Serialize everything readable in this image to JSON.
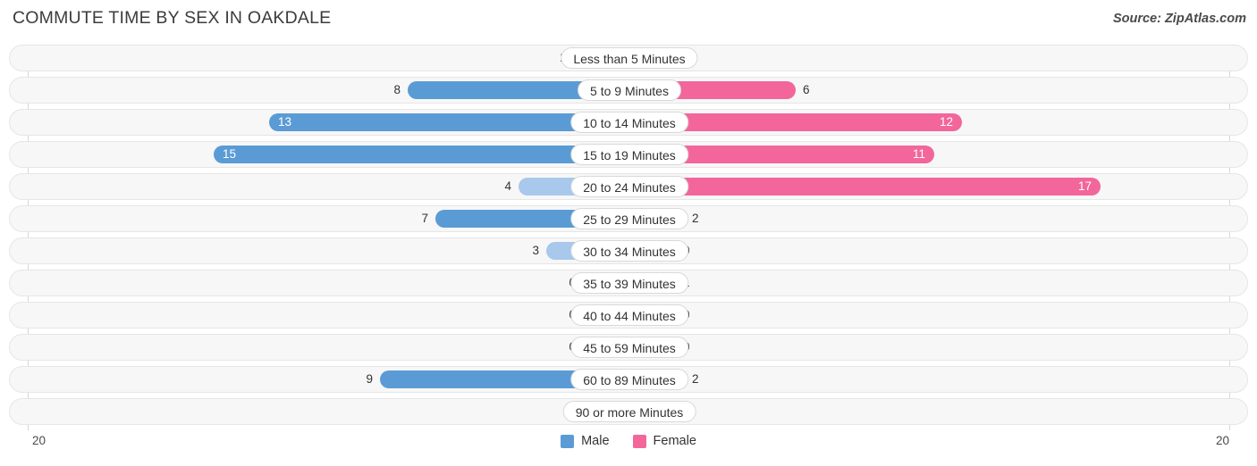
{
  "header": {
    "title": "COMMUTE TIME BY SEX IN OAKDALE",
    "source": "Source: ZipAtlas.com"
  },
  "axis": {
    "left_max_label": "20",
    "right_max_label": "20"
  },
  "legend": {
    "items": [
      {
        "label": "Male",
        "color": "#5b9bd5"
      },
      {
        "label": "Female",
        "color": "#f2669b"
      }
    ]
  },
  "chart_data": {
    "type": "bar",
    "orientation": "horizontal-diverging",
    "title": "COMMUTE TIME BY SEX IN OAKDALE",
    "xlabel": "",
    "ylabel": "",
    "xlim": [
      20,
      20
    ],
    "grid": false,
    "legend_position": "bottom-center",
    "categories": [
      "Less than 5 Minutes",
      "5 to 9 Minutes",
      "10 to 14 Minutes",
      "15 to 19 Minutes",
      "20 to 24 Minutes",
      "25 to 29 Minutes",
      "30 to 34 Minutes",
      "35 to 39 Minutes",
      "40 to 44 Minutes",
      "45 to 59 Minutes",
      "60 to 89 Minutes",
      "90 or more Minutes"
    ],
    "series": [
      {
        "name": "Male",
        "values": [
          2,
          8,
          13,
          15,
          4,
          7,
          3,
          0,
          0,
          0,
          9,
          0
        ]
      },
      {
        "name": "Female",
        "values": [
          0,
          6,
          12,
          11,
          17,
          2,
          0,
          1,
          0,
          0,
          2,
          0
        ]
      }
    ]
  },
  "rows": [
    {
      "label": "Less than 5 Minutes",
      "male": "2",
      "female": "0"
    },
    {
      "label": "5 to 9 Minutes",
      "male": "8",
      "female": "6"
    },
    {
      "label": "10 to 14 Minutes",
      "male": "13",
      "female": "12"
    },
    {
      "label": "15 to 19 Minutes",
      "male": "15",
      "female": "11"
    },
    {
      "label": "20 to 24 Minutes",
      "male": "4",
      "female": "17"
    },
    {
      "label": "25 to 29 Minutes",
      "male": "7",
      "female": "2"
    },
    {
      "label": "30 to 34 Minutes",
      "male": "3",
      "female": "0"
    },
    {
      "label": "35 to 39 Minutes",
      "male": "0",
      "female": "1"
    },
    {
      "label": "40 to 44 Minutes",
      "male": "0",
      "female": "0"
    },
    {
      "label": "45 to 59 Minutes",
      "male": "0",
      "female": "0"
    },
    {
      "label": "60 to 89 Minutes",
      "male": "9",
      "female": "2"
    },
    {
      "label": "90 or more Minutes",
      "male": "0",
      "female": "0"
    }
  ]
}
